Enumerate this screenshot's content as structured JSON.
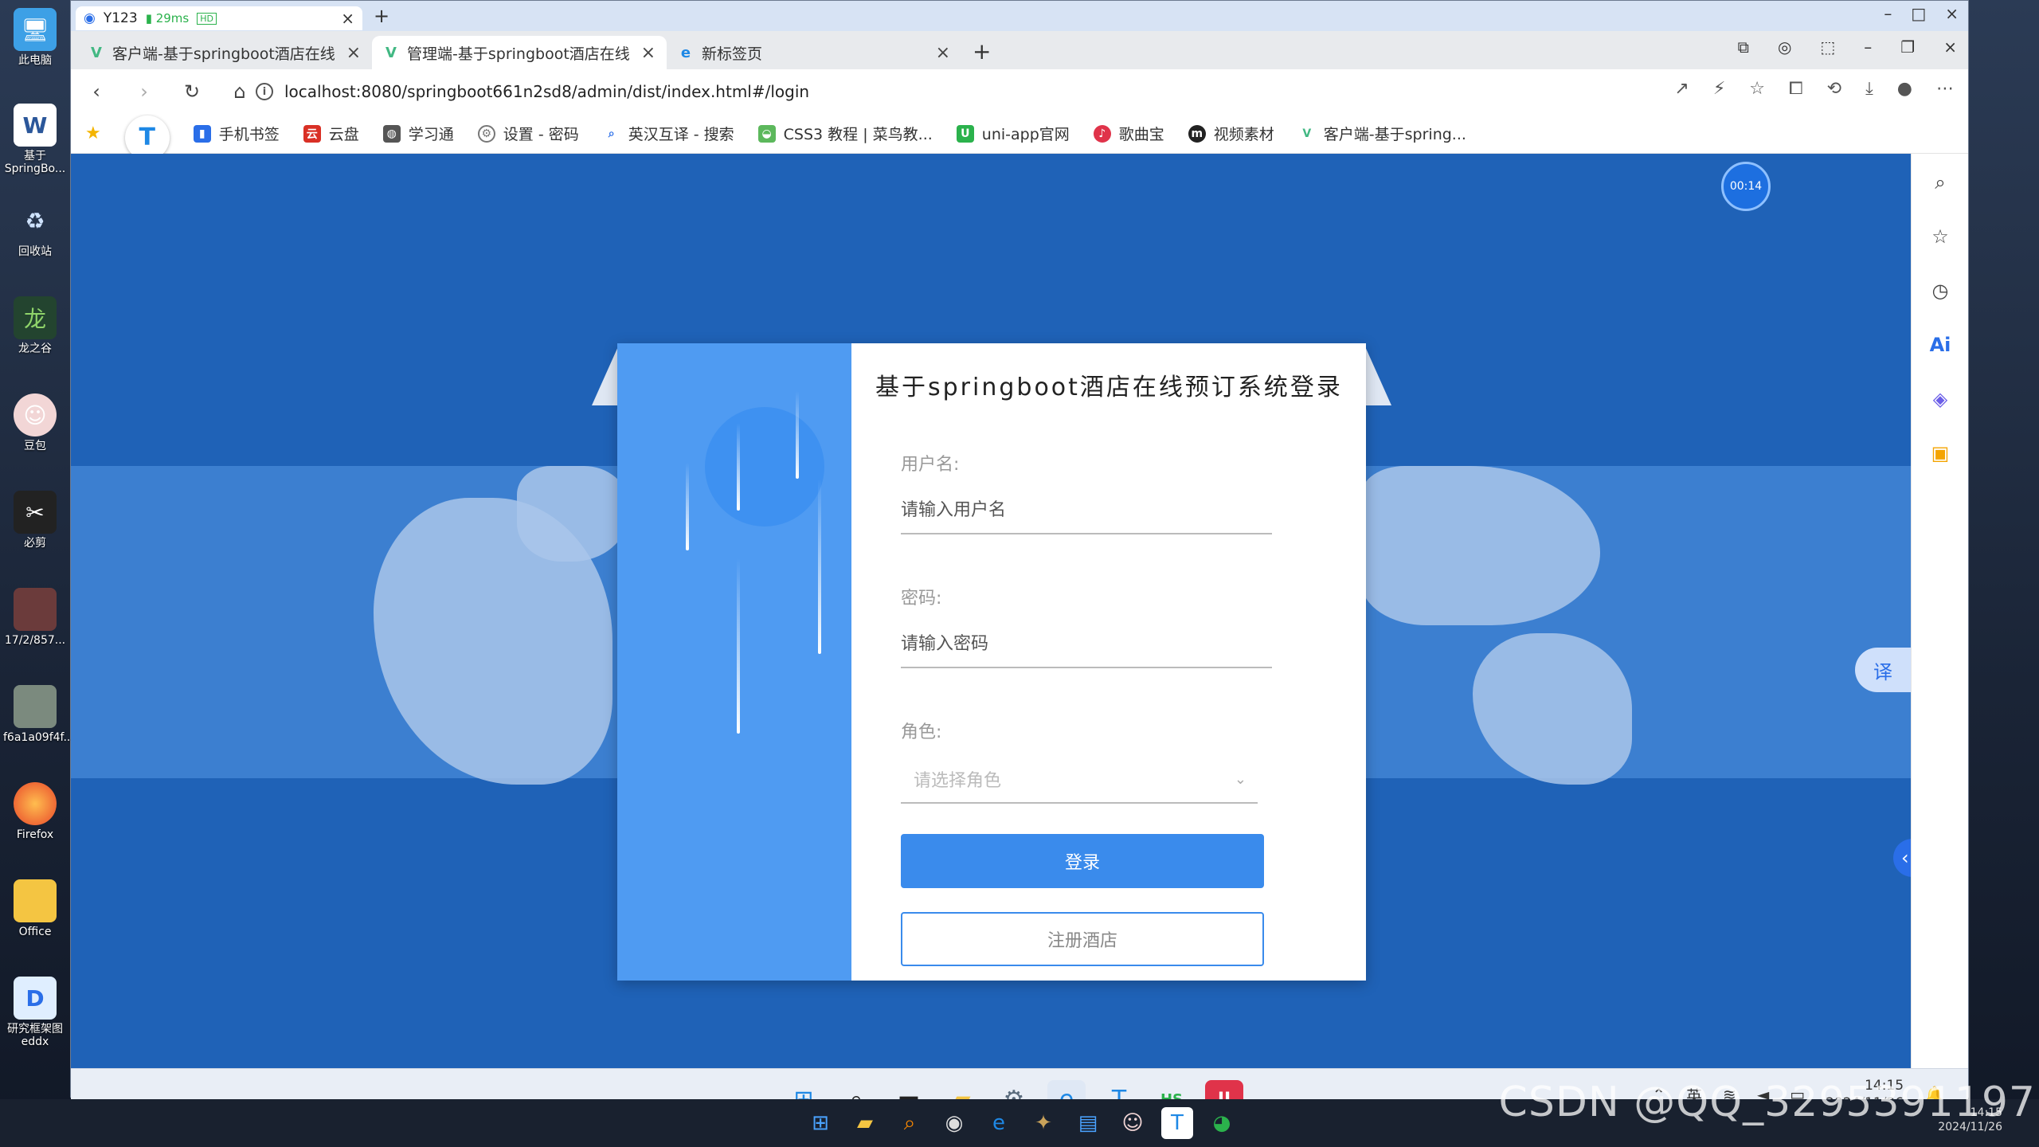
{
  "host": {
    "desktop_icons": [
      {
        "label": "此电脑",
        "icon": "computer-icon"
      },
      {
        "label": "基于SpringBo...",
        "icon": "word-doc-icon"
      },
      {
        "label": "回收站",
        "icon": "recycle-bin-icon"
      },
      {
        "label": "龙之谷",
        "icon": "game-icon"
      },
      {
        "label": "豆包",
        "icon": "doubao-icon"
      },
      {
        "label": "必剪",
        "icon": "bijian-icon"
      },
      {
        "label": "17/2/857...",
        "icon": "photo-icon"
      },
      {
        "label": "f6a1a09f4f...",
        "icon": "photo-icon"
      },
      {
        "label": "Firefox",
        "icon": "firefox-icon"
      },
      {
        "label": "Office",
        "icon": "folder-icon"
      },
      {
        "label": "研究框架图 eddx",
        "icon": "edraw-icon"
      }
    ],
    "watermark": "CSDN @QQ_3295391197",
    "clock_time": "14:15",
    "clock_date": "2024/11/26"
  },
  "vm": {
    "tab_title": "Y123",
    "ping": "29ms",
    "hd": "HD"
  },
  "browser": {
    "tabs": [
      {
        "title": "客户端-基于springboot酒店在线",
        "active": false,
        "favicon": "vue-icon"
      },
      {
        "title": "管理端-基于springboot酒店在线",
        "active": true,
        "favicon": "vue-icon"
      },
      {
        "title": "新标签页",
        "active": false,
        "favicon": "edge-icon"
      }
    ],
    "url": "localhost:8080/springboot661n2sd8/admin/dist/index.html#/login",
    "bookmarks": [
      {
        "label": "手机书签",
        "color": "#2a6ee8"
      },
      {
        "label": "云盘",
        "color": "#d93025"
      },
      {
        "label": "学习通",
        "color": "#555555"
      },
      {
        "label": "设置 - 密码",
        "color": "#777777"
      },
      {
        "label": "英汉互译 - 搜索",
        "color": "#2a6ee8"
      },
      {
        "label": "CSS3 教程 | 菜鸟教...",
        "color": "#5cb85c"
      },
      {
        "label": "uni-app官网",
        "color": "#2bb24c"
      },
      {
        "label": "歌曲宝",
        "color": "#e0334a"
      },
      {
        "label": "视频素材",
        "color": "#222222"
      },
      {
        "label": "客户端-基于spring...",
        "color": "#42b883"
      }
    ]
  },
  "page": {
    "timer": "00:14",
    "translate_label": "译",
    "login": {
      "title": "基于springboot酒店在线预订系统登录",
      "username_label": "用户名:",
      "username_placeholder": "请输入用户名",
      "password_label": "密码:",
      "password_placeholder": "请输入密码",
      "role_label": "角色:",
      "role_placeholder": "请选择角色",
      "login_button": "登录",
      "register_button": "注册酒店"
    },
    "colors": {
      "background": "#1f62b7",
      "card_left": "#4f9bf2",
      "primary_button": "#3a8bec"
    }
  },
  "vm_taskbar": {
    "ime": "英",
    "time": "14:15",
    "date": "2024/11/26"
  }
}
